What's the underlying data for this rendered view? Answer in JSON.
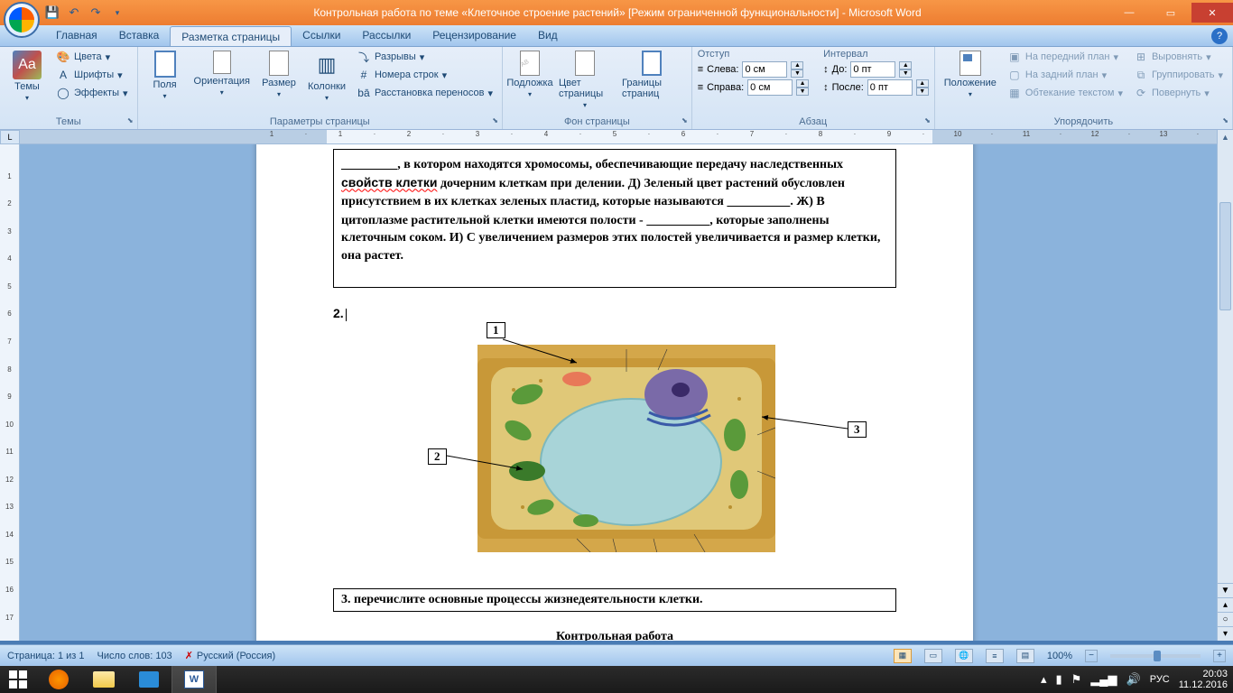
{
  "titlebar": {
    "title": "Контрольная работа по теме «Клеточное строение растений» [Режим ограниченной функциональности] - Microsoft Word"
  },
  "tabs": {
    "t0": "Главная",
    "t1": "Вставка",
    "t2": "Разметка страницы",
    "t3": "Ссылки",
    "t4": "Рассылки",
    "t5": "Рецензирование",
    "t6": "Вид"
  },
  "ribbon": {
    "themes": {
      "label": "Темы",
      "btn": "Темы",
      "colors": "Цвета",
      "fonts": "Шрифты",
      "effects": "Эффекты"
    },
    "page_setup": {
      "label": "Параметры страницы",
      "margins": "Поля",
      "orientation": "Ориентация",
      "size": "Размер",
      "columns": "Колонки",
      "breaks": "Разрывы",
      "line_numbers": "Номера строк",
      "hyphenation": "Расстановка переносов"
    },
    "page_bg": {
      "label": "Фон страницы",
      "watermark": "Подложка",
      "color": "Цвет страницы",
      "borders": "Границы страниц"
    },
    "paragraph": {
      "label": "Абзац",
      "indent": "Отступ",
      "left": "Слева:",
      "right": "Справа:",
      "left_val": "0 см",
      "right_val": "0 см",
      "spacing": "Интервал",
      "before": "До:",
      "after": "После:",
      "before_val": "0 пт",
      "after_val": "0 пт"
    },
    "arrange": {
      "label": "Упорядочить",
      "position": "Положение",
      "front": "На передний план",
      "back": "На задний план",
      "wrap": "Обтекание текстом",
      "align": "Выровнять",
      "group": "Группировать",
      "rotate": "Повернуть"
    }
  },
  "document": {
    "text_box": ", в котором находятся хромосомы, обеспечивающие передачу наследственных свойств клетки дочерним клеткам при делении. Д) Зеленый цвет растений обусловлен присутствием в их клетках зеленых пластид, которые называются ___________. Ж) В цитоплазме растительной клетки имеются полости - ___________, которые заполнены клеточным соком. И) С увеличением размеров этих полостей увеличивается и размер клетки, она растет.",
    "q2": "2.",
    "q3": "3.  перечислите основные процессы жизнедеятельности клетки.",
    "title": "Контрольная работа",
    "labels": {
      "l1": "1",
      "l2": "2",
      "l3": "3"
    }
  },
  "statusbar": {
    "page": "Страница: 1 из 1",
    "words": "Число слов: 103",
    "lang": "Русский (Россия)",
    "zoom": "100%"
  },
  "taskbar": {
    "lang": "РУС",
    "time": "20:03",
    "date": "11.12.2016"
  }
}
